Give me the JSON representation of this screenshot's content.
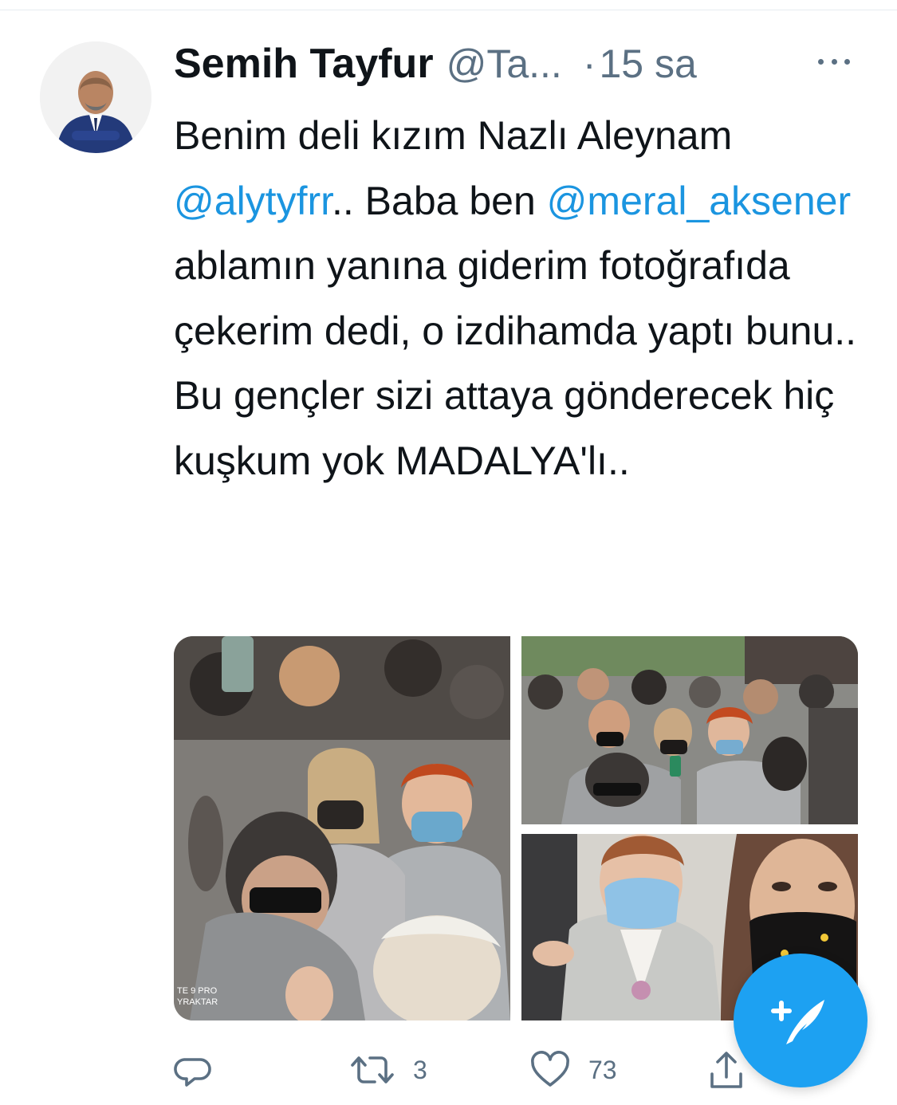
{
  "tweet": {
    "author_name": "Semih Tayfur",
    "handle": "@Ta...",
    "separator": "·",
    "time": "15 sa",
    "text_segments": [
      {
        "text": "Benim deli kızım  Nazlı Aleynam ",
        "type": "text"
      },
      {
        "text": "@alytyfrr",
        "type": "mention"
      },
      {
        "text": ".. Baba ben ",
        "type": "text"
      },
      {
        "text": "@meral_aksener",
        "type": "mention"
      },
      {
        "text": " ablamın yanına giderim fotoğrafıda çekerim dedi, o izdihamda yaptı bunu.. Bu gençler sizi attaya gönderecek hiç kuşkum yok MADALYA'lı..",
        "type": "text"
      }
    ],
    "media": [
      {
        "description_icon": "photo",
        "watermark_line1": "TE 9 PRO",
        "watermark_line2": "YRAKTAR"
      },
      {
        "description_icon": "photo"
      },
      {
        "description_icon": "photo"
      }
    ],
    "actions": {
      "reply_count": "",
      "retweet_count": "3",
      "like_count": "73"
    }
  },
  "icons": {
    "reply": "reply-icon",
    "retweet": "retweet-icon",
    "like": "heart-icon",
    "share": "share-icon",
    "more": "more-icon",
    "compose": "compose-tweet-icon"
  },
  "colors": {
    "accent": "#1da1f2",
    "mention": "#1b95e0",
    "secondary_text": "#5b7083",
    "primary_text": "#0f1419"
  }
}
